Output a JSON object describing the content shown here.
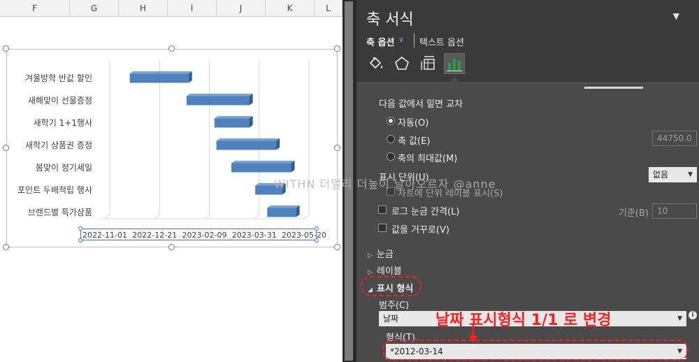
{
  "sheet": {
    "columns": [
      "F",
      "G",
      "H",
      "I",
      "J",
      "K",
      "L"
    ]
  },
  "chart": {
    "categories": [
      "겨울방학 반값 할인",
      "새해맞이 선물증정",
      "새학기 1+1행사",
      "새학기 상품권 증정",
      "봄맞이 정기세일",
      "포인트 두배적립 행사",
      "브랜드별 특가상품"
    ],
    "x_ticks": [
      "2022-11-01",
      "2022-12-21",
      "2023-02-09",
      "2023-03-31",
      "2023-05-20"
    ],
    "bar_color": "#4f81bd",
    "watermark": "WITHN 더멀리 더높이 날아오르자 @anne"
  },
  "chart_data": {
    "type": "bar",
    "orientation": "horizontal-gantt",
    "categories": [
      "겨울방학 반값 할인",
      "새해맞이 선물증정",
      "새학기 1+1행사",
      "새학기 상품권 증정",
      "봄맞이 정기세일",
      "포인트 두배적립 행사",
      "브랜드별 특가상품"
    ],
    "start": [
      "2022-11-26",
      "2023-01-22",
      "2023-02-19",
      "2023-02-21",
      "2023-03-08",
      "2023-04-01",
      "2023-04-13"
    ],
    "end": [
      "2023-01-24",
      "2023-03-26",
      "2023-03-26",
      "2023-04-22",
      "2023-05-07",
      "2023-04-28",
      "2023-05-12"
    ],
    "x_ticks": [
      "2022-11-01",
      "2022-12-21",
      "2023-02-09",
      "2023-03-31",
      "2023-05-20"
    ],
    "grid": true
  },
  "pane": {
    "title": "축 서식",
    "menu_icon": "chevron-down-icon",
    "tab_axis_options": "축 옵션",
    "tab_text_options": "텍스트 옵션",
    "icons": [
      "fill-bucket-icon",
      "pentagon-icon",
      "size-properties-icon",
      "bar-chart-icon"
    ],
    "cross_heading": "다음 값에서 밑면 교차",
    "opt_auto": "자동(O)",
    "opt_value": "축 값(E)",
    "opt_max": "축의 최대값(M)",
    "value_field": "44750.0",
    "display_units_label": "표시 단위(U)",
    "display_units_value": "없음",
    "show_units_label": "차트에 단위 레이블 표시(S)",
    "log_label": "로그 눈금 간격(L)",
    "base_label": "기준(B)",
    "base_value": "10",
    "reverse_label": "값을 거꾸로(V)",
    "sec_ticks": "눈금",
    "sec_labels": "레이블",
    "sec_number": "표시 형식",
    "category_label": "범주(C)",
    "category_value": "날짜",
    "format_label": "형식(T)",
    "format_value": "*2012-03-14",
    "annotation": "날짜 표시형식 1/1 로 변경"
  }
}
